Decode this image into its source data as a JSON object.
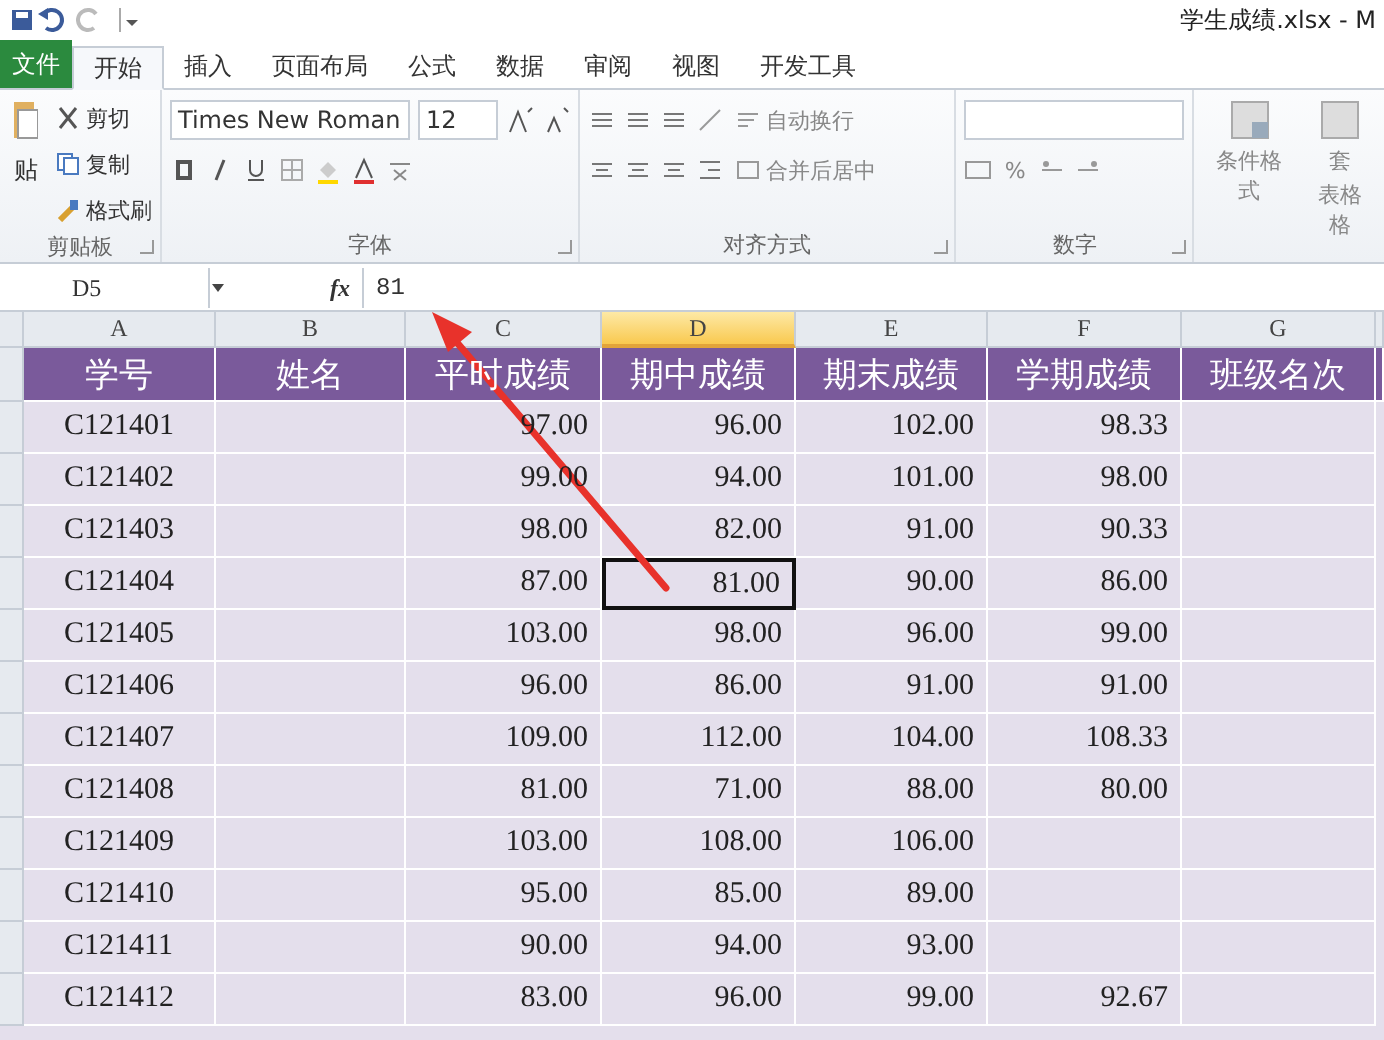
{
  "title_bar": {
    "title": "学生成绩.xlsx - M"
  },
  "tabs": [
    {
      "label": "文件",
      "kind": "file",
      "selected": false
    },
    {
      "label": "开始",
      "kind": "tab",
      "selected": true
    },
    {
      "label": "插入",
      "kind": "tab",
      "selected": false
    },
    {
      "label": "页面布局",
      "kind": "tab",
      "selected": false
    },
    {
      "label": "公式",
      "kind": "tab",
      "selected": false
    },
    {
      "label": "数据",
      "kind": "tab",
      "selected": false
    },
    {
      "label": "审阅",
      "kind": "tab",
      "selected": false
    },
    {
      "label": "视图",
      "kind": "tab",
      "selected": false
    },
    {
      "label": "开发工具",
      "kind": "tab",
      "selected": false
    }
  ],
  "ribbon": {
    "clipboard": {
      "paste": "贴",
      "cut": "剪切",
      "copy": "复制",
      "format_painter": "格式刷",
      "group": "剪贴板"
    },
    "font": {
      "family": "Times New Roman",
      "size": "12",
      "group": "字体"
    },
    "alignment": {
      "wrap": "自动换行",
      "merge": "合并后居中",
      "group": "对齐方式"
    },
    "number": {
      "percent": "%",
      "group": "数字"
    },
    "styles": {
      "conditional": "条件格式",
      "format_table_top": "套",
      "format_table_bottom": "表格格"
    }
  },
  "formula_bar": {
    "name_box": "D5",
    "function_button": "fx",
    "value": "81"
  },
  "sheet": {
    "columns": [
      {
        "letter": "A",
        "selected": false
      },
      {
        "letter": "B",
        "selected": false
      },
      {
        "letter": "C",
        "selected": false
      },
      {
        "letter": "D",
        "selected": true
      },
      {
        "letter": "E",
        "selected": false
      },
      {
        "letter": "F",
        "selected": false
      },
      {
        "letter": "G",
        "selected": false
      }
    ],
    "rows": [
      {
        "kind": "header",
        "cells": [
          {
            "text": "学号",
            "selected": false
          },
          {
            "text": "姓名",
            "selected": false
          },
          {
            "text": "平时成绩",
            "selected": false
          },
          {
            "text": "期中成绩",
            "selected": false
          },
          {
            "text": "期末成绩",
            "selected": false
          },
          {
            "text": "学期成绩",
            "selected": false
          },
          {
            "text": "班级名次",
            "selected": false
          }
        ]
      },
      {
        "kind": "data",
        "cells": [
          {
            "text": "C121401",
            "selected": false
          },
          {
            "selected": false
          },
          {
            "text": "97.00",
            "selected": false
          },
          {
            "text": "96.00",
            "selected": false
          },
          {
            "text": "102.00",
            "selected": false
          },
          {
            "text": "98.33",
            "selected": false
          },
          {
            "selected": false
          }
        ]
      },
      {
        "kind": "data",
        "cells": [
          {
            "text": "C121402",
            "selected": false
          },
          {
            "selected": false
          },
          {
            "text": "99.00",
            "selected": false
          },
          {
            "text": "94.00",
            "selected": false
          },
          {
            "text": "101.00",
            "selected": false
          },
          {
            "text": "98.00",
            "selected": false
          },
          {
            "selected": false
          }
        ]
      },
      {
        "kind": "data",
        "cells": [
          {
            "text": "C121403",
            "selected": false
          },
          {
            "selected": false
          },
          {
            "text": "98.00",
            "selected": false
          },
          {
            "text": "82.00",
            "selected": false
          },
          {
            "text": "91.00",
            "selected": false
          },
          {
            "text": "90.33",
            "selected": false
          },
          {
            "selected": false
          }
        ]
      },
      {
        "kind": "data",
        "cells": [
          {
            "text": "C121404",
            "selected": false
          },
          {
            "selected": false
          },
          {
            "text": "87.00",
            "selected": false
          },
          {
            "text": "81.00",
            "selected": true
          },
          {
            "text": "90.00",
            "selected": false
          },
          {
            "text": "86.00",
            "selected": false
          },
          {
            "selected": false
          }
        ]
      },
      {
        "kind": "data",
        "cells": [
          {
            "text": "C121405",
            "selected": false
          },
          {
            "selected": false
          },
          {
            "text": "103.00",
            "selected": false
          },
          {
            "text": "98.00",
            "selected": false
          },
          {
            "text": "96.00",
            "selected": false
          },
          {
            "text": "99.00",
            "selected": false
          },
          {
            "selected": false
          }
        ]
      },
      {
        "kind": "data",
        "cells": [
          {
            "text": "C121406",
            "selected": false
          },
          {
            "selected": false
          },
          {
            "text": "96.00",
            "selected": false
          },
          {
            "text": "86.00",
            "selected": false
          },
          {
            "text": "91.00",
            "selected": false
          },
          {
            "text": "91.00",
            "selected": false
          },
          {
            "selected": false
          }
        ]
      },
      {
        "kind": "data",
        "cells": [
          {
            "text": "C121407",
            "selected": false
          },
          {
            "selected": false
          },
          {
            "text": "109.00",
            "selected": false
          },
          {
            "text": "112.00",
            "selected": false
          },
          {
            "text": "104.00",
            "selected": false
          },
          {
            "text": "108.33",
            "selected": false
          },
          {
            "selected": false
          }
        ]
      },
      {
        "kind": "data",
        "cells": [
          {
            "text": "C121408",
            "selected": false
          },
          {
            "selected": false
          },
          {
            "text": "81.00",
            "selected": false
          },
          {
            "text": "71.00",
            "selected": false
          },
          {
            "text": "88.00",
            "selected": false
          },
          {
            "text": "80.00",
            "selected": false
          },
          {
            "selected": false
          }
        ]
      },
      {
        "kind": "data",
        "cells": [
          {
            "text": "C121409",
            "selected": false
          },
          {
            "selected": false
          },
          {
            "text": "103.00",
            "selected": false
          },
          {
            "text": "108.00",
            "selected": false
          },
          {
            "text": "106.00",
            "selected": false
          },
          {
            "selected": false
          },
          {
            "selected": false
          }
        ]
      },
      {
        "kind": "data",
        "cells": [
          {
            "text": "C121410",
            "selected": false
          },
          {
            "selected": false
          },
          {
            "text": "95.00",
            "selected": false
          },
          {
            "text": "85.00",
            "selected": false
          },
          {
            "text": "89.00",
            "selected": false
          },
          {
            "selected": false
          },
          {
            "selected": false
          }
        ]
      },
      {
        "kind": "data",
        "cells": [
          {
            "text": "C121411",
            "selected": false
          },
          {
            "selected": false
          },
          {
            "text": "90.00",
            "selected": false
          },
          {
            "text": "94.00",
            "selected": false
          },
          {
            "text": "93.00",
            "selected": false
          },
          {
            "selected": false
          },
          {
            "selected": false
          }
        ]
      },
      {
        "kind": "data",
        "cells": [
          {
            "text": "C121412",
            "selected": false
          },
          {
            "selected": false
          },
          {
            "text": "83.00",
            "selected": false
          },
          {
            "text": "96.00",
            "selected": false
          },
          {
            "text": "99.00",
            "selected": false
          },
          {
            "text": "92.67",
            "selected": false
          },
          {
            "selected": false
          }
        ]
      }
    ]
  },
  "annotations": [
    {
      "kind": "arrow"
    }
  ]
}
